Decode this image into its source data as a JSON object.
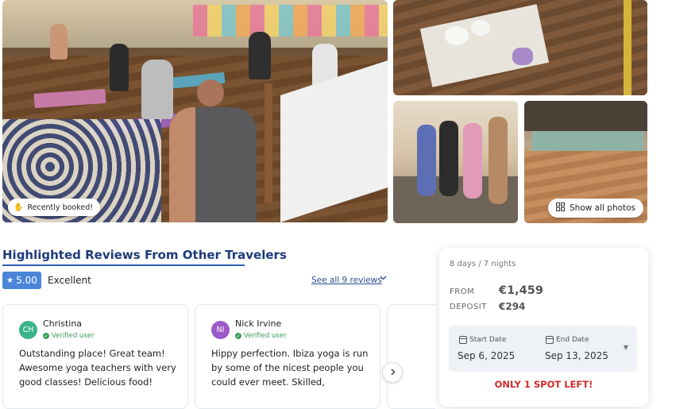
{
  "gallery": {
    "recently_booked_label": "Recently booked!",
    "recently_booked_icon": "hand-emoji-icon",
    "show_all_label": "Show all photos",
    "show_all_icon": "grid-icon"
  },
  "reviews": {
    "heading": "Highlighted Reviews From Other Travelers",
    "score": "5.00",
    "score_word": "Excellent",
    "see_all_label": "See all 9 reviews",
    "items": [
      {
        "initials": "CH",
        "name": "Christina",
        "verified": "Verified user",
        "avatar_color": "#3bb38a",
        "text": "Outstanding place! Great team! Awesome yoga teachers with very good classes! Delicious food!"
      },
      {
        "initials": "NI",
        "name": "Nick Irvine",
        "verified": "Verified user",
        "avatar_color": "#9b59c9",
        "text": "Hippy perfection. Ibiza yoga is run by some of the nicest people you could ever meet. Skilled,"
      }
    ]
  },
  "booking": {
    "duration": "8 days / 7 nights",
    "from_label": "FROM",
    "from_price": "€1,459",
    "deposit_label": "DEPOSIT",
    "deposit_price": "€294",
    "start_label": "Start Date",
    "start_value": "Sep 6, 2025",
    "end_label": "End Date",
    "end_value": "Sep 13, 2025",
    "spot_notice": "ONLY 1 SPOT LEFT!"
  },
  "colors": {
    "accent_blue": "#2d5fb4",
    "score_badge": "#4a85d8",
    "alert_red": "#d12b2b"
  }
}
